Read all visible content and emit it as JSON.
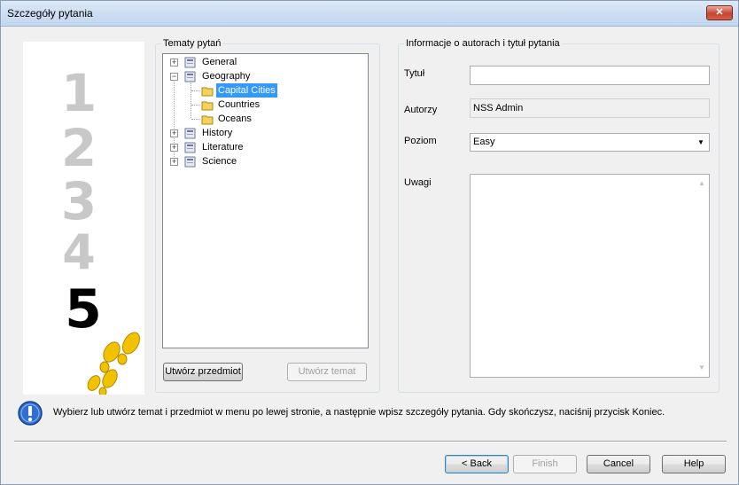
{
  "window": {
    "title": "Szczegóły pytania",
    "close_label": "✕"
  },
  "topics": {
    "group_label": "Tematy pytań",
    "tree": [
      {
        "label": "General",
        "expander": "+",
        "level": 0
      },
      {
        "label": "Geography",
        "expander": "−",
        "level": 0
      },
      {
        "label": "Capital Cities",
        "level": 1,
        "selected": true
      },
      {
        "label": "Countries",
        "level": 1
      },
      {
        "label": "Oceans",
        "level": 1
      },
      {
        "label": "History",
        "expander": "+",
        "level": 0
      },
      {
        "label": "Literature",
        "expander": "+",
        "level": 0
      },
      {
        "label": "Science",
        "expander": "+",
        "level": 0
      }
    ],
    "create_subject_button": "Utwórz przedmiot",
    "create_topic_button": "Utwórz temat"
  },
  "info": {
    "group_label": "Informacje o autorach i tytuł pytania",
    "title_label": "Tytuł",
    "title_value": "",
    "authors_label": "Autorzy",
    "authors_value": "NSS Admin",
    "level_label": "Poziom",
    "level_value": "Easy",
    "notes_label": "Uwagi",
    "notes_value": ""
  },
  "step_image": {
    "steps": [
      "1",
      "2",
      "3",
      "4",
      "5"
    ],
    "current_step": 5
  },
  "hint": "Wybierz lub utwórz temat i przedmiot w menu po lewej stronie, a następnie wpisz szczegóły pytania. Gdy skończysz, naciśnij przycisk Koniec.",
  "footer": {
    "back_button": "< Back",
    "finish_button": "Finish",
    "cancel_button": "Cancel",
    "help_button": "Help"
  },
  "colors": {
    "selection": "#3399ff",
    "step_inactive": "#c8c8c8",
    "step_active": "#000000",
    "footprints": "#f2c200"
  }
}
